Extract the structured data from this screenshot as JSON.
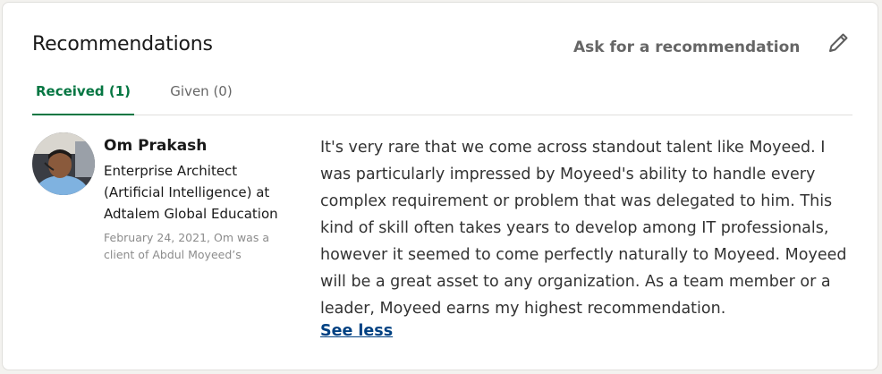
{
  "section": {
    "title": "Recommendations",
    "ask_link": "Ask for a recommendation",
    "edit_icon": "pencil-icon"
  },
  "tabs": [
    {
      "label": "Received (1)",
      "active": true
    },
    {
      "label": "Given (0)",
      "active": false
    }
  ],
  "recommendation": {
    "name": "Om Prakash",
    "headline": "Enterprise Architect (Artificial Intelligence) at Adtalem Global Education",
    "meta": "February 24, 2021, Om was a client of Abdul Moyeed’s",
    "text": "It's very rare that we come across standout talent like Moyeed. I was particularly impressed by Moyeed's ability to handle every complex requirement or problem that was delegated to him. This kind of skill often takes years to develop among IT professionals, however it seemed to come perfectly naturally to Moyeed. Moyeed will be a great asset to any organization. As a team member or a leader, Moyeed earns my highest recommendation.",
    "see_less": "See less"
  },
  "colors": {
    "accent": "#057642",
    "link": "#004182",
    "text": "#191919",
    "muted": "#666666"
  }
}
